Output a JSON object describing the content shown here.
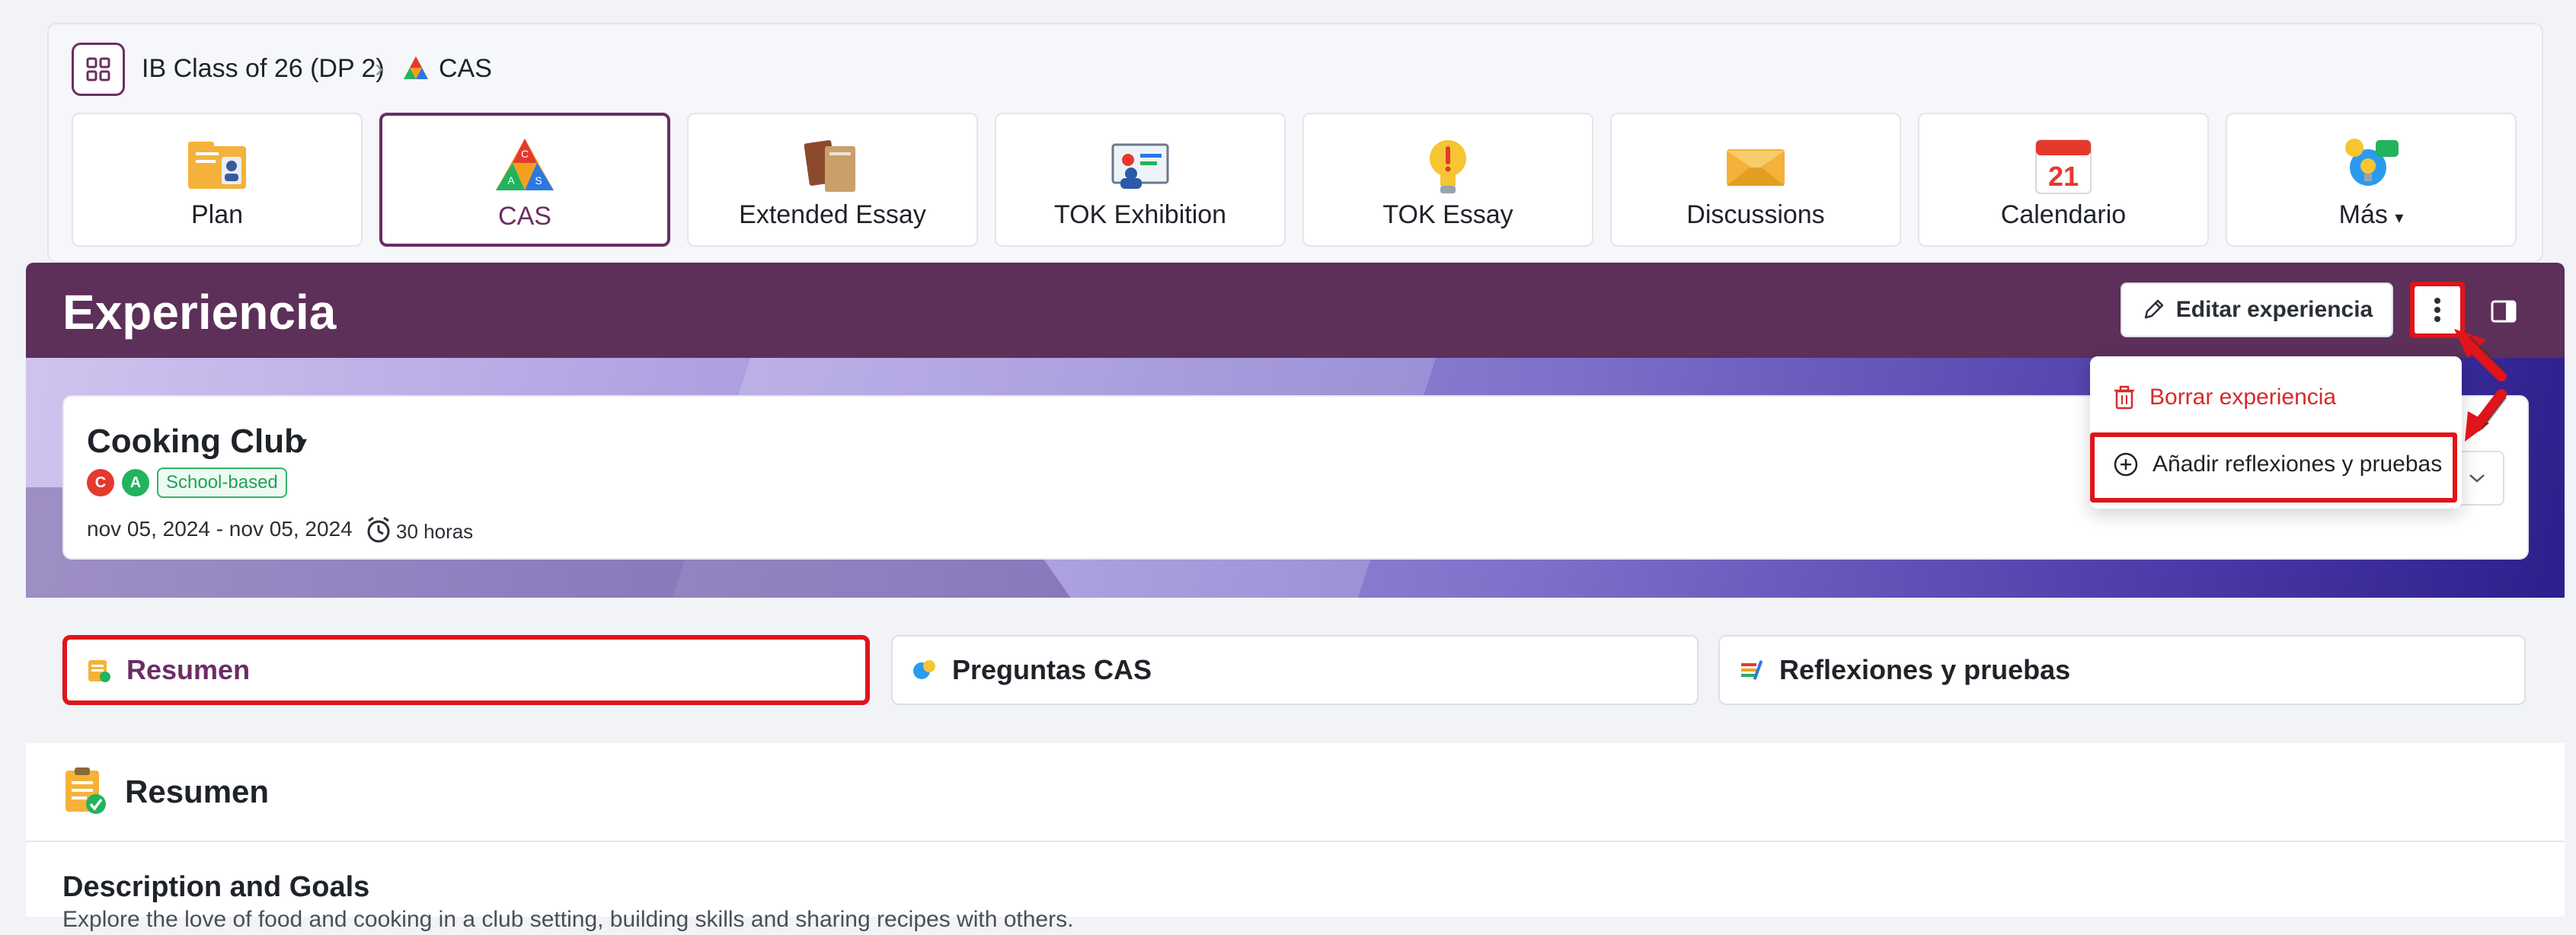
{
  "breadcrumb": {
    "course": "IB Class of 26 (DP 2)",
    "separator": "›",
    "current": "CAS"
  },
  "nav_tiles": [
    {
      "label": "Plan",
      "icon": "plan-folder-icon"
    },
    {
      "label": "CAS",
      "icon": "cas-triangle-icon",
      "active": true
    },
    {
      "label": "Extended Essay",
      "icon": "books-icon"
    },
    {
      "label": "TOK Exhibition",
      "icon": "exhibition-board-icon"
    },
    {
      "label": "TOK Essay",
      "icon": "lightbulb-icon"
    },
    {
      "label": "Discussions",
      "icon": "envelope-icon"
    },
    {
      "label": "Calendario",
      "icon": "calendar-icon",
      "calendar_day": "21"
    },
    {
      "label": "Más",
      "icon": "more-apps-icon",
      "caret": "▾"
    }
  ],
  "header": {
    "title": "Experiencia",
    "edit_label": "Editar experiencia"
  },
  "experience": {
    "title": "Cooking Club",
    "caret": "▾",
    "badges": [
      {
        "letter": "C",
        "color": "#e5392e"
      },
      {
        "letter": "A",
        "color": "#22b35e"
      }
    ],
    "tag": "School-based",
    "dates": "nov 05, 2024 - nov 05, 2024",
    "hours": "30 horas"
  },
  "menu": {
    "delete_label": "Borrar experiencia",
    "add_label": "Añadir reflexiones y pruebas"
  },
  "tabs": [
    {
      "label": "Resumen",
      "active": true
    },
    {
      "label": "Preguntas CAS"
    },
    {
      "label": "Reflexiones y pruebas"
    }
  ],
  "summary": {
    "title": "Resumen",
    "section_title": "Description and Goals",
    "section_text": "Explore the love of food and cooking in a club setting, building skills and sharing recipes with others."
  },
  "colors": {
    "brand": "#5c3059",
    "accent": "#6b2e63",
    "highlight": "#e0141b",
    "danger": "#d62a2a"
  }
}
